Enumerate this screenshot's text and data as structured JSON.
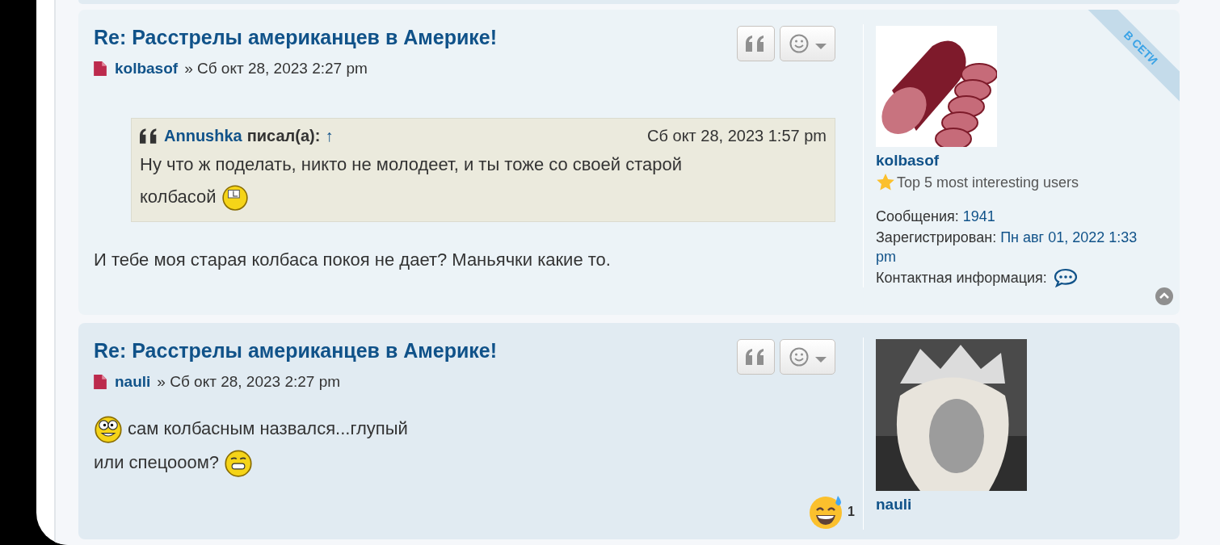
{
  "posts": [
    {
      "title": "Re: Расстрелы американцев в Америке!",
      "author": "kolbasof",
      "separator": "»",
      "date": "Сб окт 28, 2023 2:27 pm",
      "online_label": "В СЕТИ",
      "back_to_top": true,
      "quote": {
        "author": "Annushka",
        "wrote": "писал(а):",
        "link": "↑",
        "date": "Сб окт 28, 2023 1:57 pm",
        "lines": [
          [
            {
              "kind": "text",
              "text": "Ну что ж поделать, никто не молодеет, и ты тоже со своей старой"
            }
          ],
          [
            {
              "kind": "text",
              "text": "колбасой"
            },
            {
              "kind": "clock_smiley"
            }
          ]
        ]
      },
      "lines": [
        [
          {
            "kind": "text",
            "text": "И тебе моя старая колбаса покоя не дает? Маньячки какие то."
          }
        ]
      ],
      "profile": {
        "username": "kolbasof",
        "rank": "Top 5 most interesting users",
        "fields": [
          {
            "kind": "text",
            "label": "Сообщения:",
            "value": "1941"
          },
          {
            "kind": "text",
            "label": "Зарегистрирован:",
            "value": "Пн авг 01, 2022 1:33 pm"
          },
          {
            "kind": "contact",
            "label": "Контактная информация:"
          }
        ]
      }
    },
    {
      "title": "Re: Расстрелы американцев в Америке!",
      "author": "nauli",
      "separator": "»",
      "date": "Сб окт 28, 2023 2:27 pm",
      "lines": [
        [
          {
            "kind": "crazy_smiley"
          },
          {
            "kind": "text",
            "text": "сам колбасным назвался...глупый"
          }
        ],
        [
          {
            "kind": "text",
            "text": "или спецооом?"
          },
          {
            "kind": "grin_smiley"
          }
        ]
      ],
      "reaction": {
        "kind": "sweat_smile",
        "count": "1"
      },
      "profile": {
        "username": "nauli"
      }
    }
  ]
}
